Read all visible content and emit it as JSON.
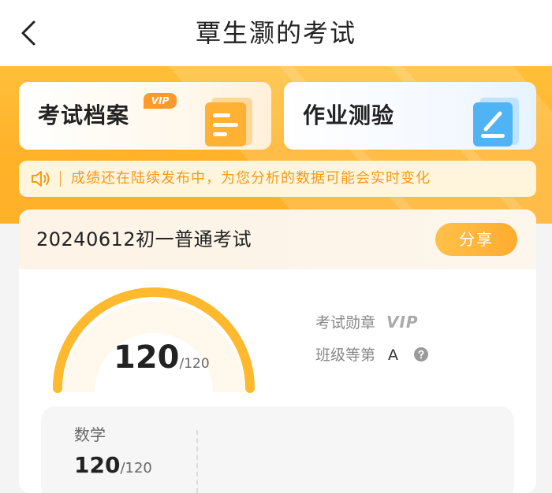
{
  "header": {
    "title": "覃生灏的考试"
  },
  "cards": {
    "archive": {
      "label": "考试档案",
      "badge": "VIP"
    },
    "homework": {
      "label": "作业测验"
    }
  },
  "notice": {
    "text": "成绩还在陆续发布中，为您分析的数据可能会实时变化"
  },
  "exam": {
    "name": "20240612初一普通考试",
    "share_label": "分享",
    "score": "120",
    "total": "/120",
    "score_fraction": 1.0,
    "badge_label": "考试勋章",
    "badge_value": "VIP",
    "rank_label": "班级等第",
    "rank_value": "A"
  },
  "subjects": [
    {
      "name": "数学",
      "score": "120",
      "total": "/120"
    }
  ],
  "colors": {
    "accent": "#ffb12a",
    "notice_text": "#f49a1a",
    "gauge": "#ffb92e"
  },
  "icons": {
    "back": "chevron-left-icon",
    "archive": "document-icon",
    "homework": "pencil-icon",
    "notice": "speaker-icon",
    "help": "question-circle-icon"
  }
}
